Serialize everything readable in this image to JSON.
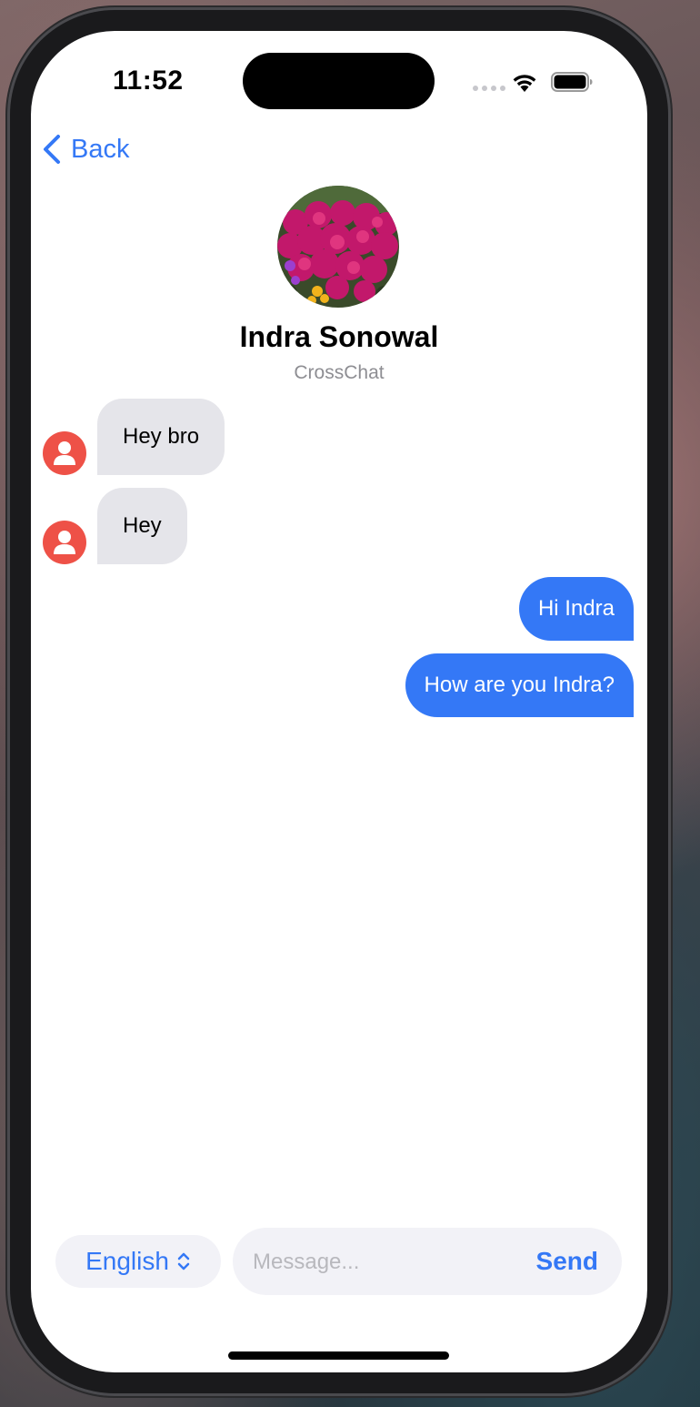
{
  "status_bar": {
    "time": "11:52"
  },
  "nav": {
    "back_label": "Back"
  },
  "contact": {
    "name": "Indra Sonowal",
    "subtitle": "CrossChat",
    "avatar_icon": "flower-photo"
  },
  "messages": [
    {
      "direction": "incoming",
      "text": "Hey bro"
    },
    {
      "direction": "incoming",
      "text": "Hey"
    },
    {
      "direction": "outgoing",
      "text": "Hi Indra"
    },
    {
      "direction": "outgoing",
      "text": "How are you Indra?"
    }
  ],
  "composer": {
    "language": "English",
    "placeholder": "Message...",
    "value": "",
    "send_label": "Send"
  },
  "colors": {
    "accent": "#3478f6",
    "incoming_bubble": "#e5e5ea",
    "outgoing_bubble": "#3478f6",
    "user_avatar": "#ee5147"
  }
}
